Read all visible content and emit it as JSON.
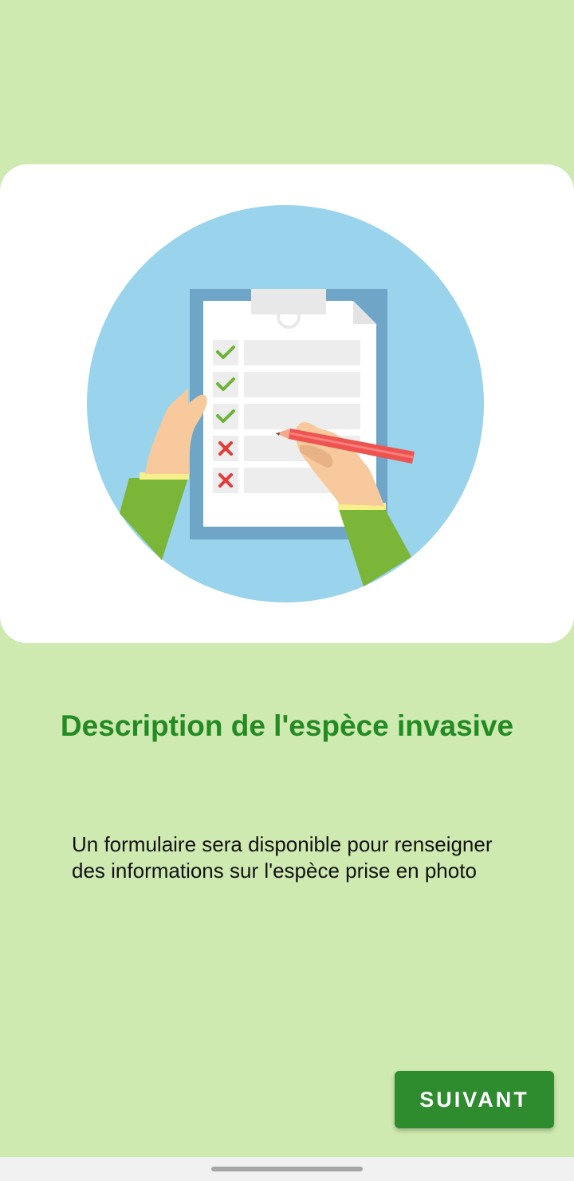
{
  "onboarding": {
    "title": "Description de l'espèce invasive",
    "description": "Un formulaire sera disponible pour renseigner des informations sur l'espèce prise en photo",
    "next_button_label": "SUIVANT",
    "illustration": "clipboard-checklist-illustration"
  },
  "colors": {
    "background": "#cfeab0",
    "title": "#228b22",
    "button": "#2e8b2e",
    "card": "#ffffff",
    "circle": "#9ad3ec"
  }
}
